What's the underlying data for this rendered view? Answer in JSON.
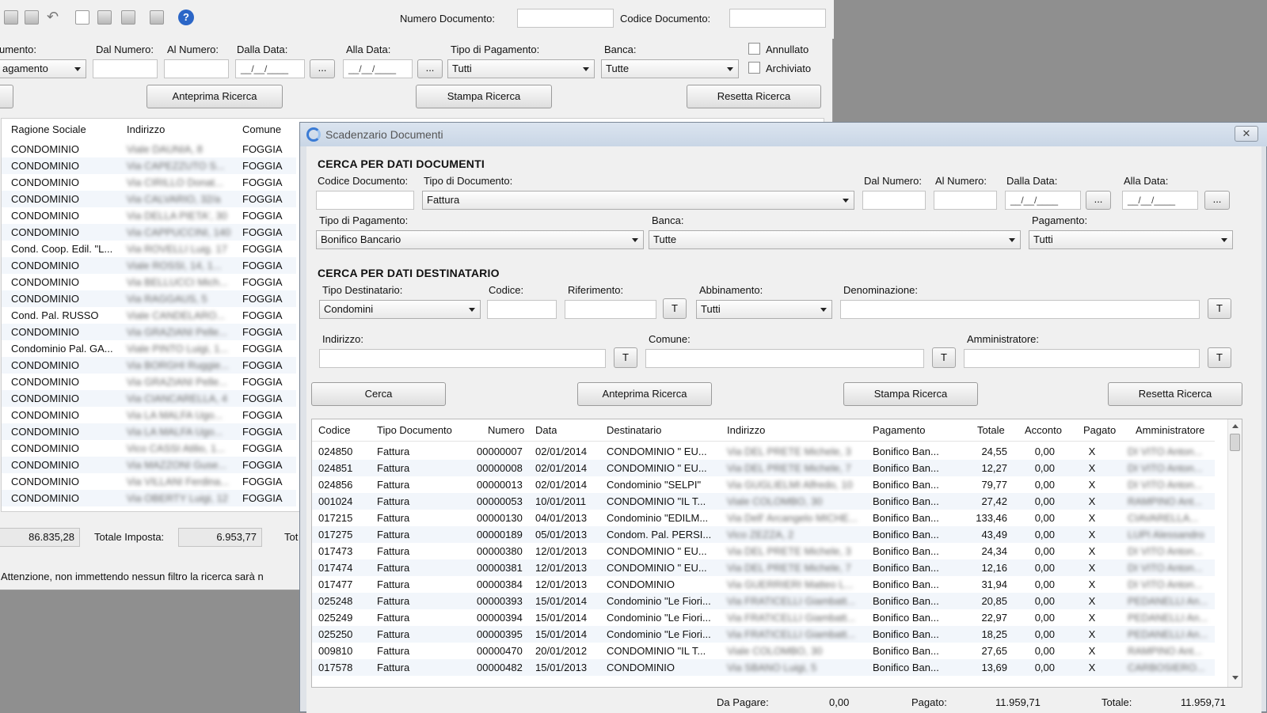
{
  "back_window": {
    "numero_documento_label": "Numero Documento:",
    "codice_documento_label": "Codice Documento:",
    "labels": {
      "documento": "umento:",
      "dal_numero": "Dal Numero:",
      "al_numero": "Al Numero:",
      "dalla_data": "Dalla Data:",
      "alla_data": "Alla Data:",
      "tipo_pagamento": "Tipo di Pagamento:",
      "banca": "Banca:"
    },
    "documento_value": "agamento",
    "date_placeholder": "__/__/____",
    "tipo_pagamento_value": "Tutti",
    "banca_value": "Tutte",
    "annullato_label": "Annullato",
    "archiviato_label": "Archiviato",
    "ellipsis": "...",
    "buttons": {
      "anteprima": "Anteprima Ricerca",
      "stampa": "Stampa Ricerca",
      "resetta": "Resetta Ricerca"
    },
    "table": {
      "columns": [
        "Ragione Sociale",
        "Indirizzo",
        "Comune"
      ],
      "rows": [
        {
          "ragione": "CONDOMINIO",
          "indirizzo": "Viale DAUNIA, 8",
          "comune": "FOGGIA"
        },
        {
          "ragione": "CONDOMINIO",
          "indirizzo": "Via CAPEZZUTO S...",
          "comune": "FOGGIA"
        },
        {
          "ragione": "CONDOMINIO",
          "indirizzo": "Via CIRILLO Donat...",
          "comune": "FOGGIA"
        },
        {
          "ragione": "CONDOMINIO",
          "indirizzo": "Via CALVARIO, 32/a",
          "comune": "FOGGIA"
        },
        {
          "ragione": "CONDOMINIO",
          "indirizzo": "Via DELLA PIETA', 30",
          "comune": "FOGGIA"
        },
        {
          "ragione": "CONDOMINIO",
          "indirizzo": "Via CAPPUCCINI, 140",
          "comune": "FOGGIA"
        },
        {
          "ragione": "Cond. Coop. Edil. \"L...",
          "indirizzo": "Via ROVELLI Luig. 17",
          "comune": "FOGGIA"
        },
        {
          "ragione": "CONDOMINIO",
          "indirizzo": "Viale ROSSI, 14, 1...",
          "comune": "FOGGIA"
        },
        {
          "ragione": "CONDOMINIO",
          "indirizzo": "Via BELLUCCI Mich...",
          "comune": "FOGGIA"
        },
        {
          "ragione": "CONDOMINIO",
          "indirizzo": "Via RAGGAUS, 5",
          "comune": "FOGGIA"
        },
        {
          "ragione": "Cond. Pal. RUSSO",
          "indirizzo": "Viale CANDELARO...",
          "comune": "FOGGIA"
        },
        {
          "ragione": "CONDOMINIO",
          "indirizzo": "Via GRAZIANI Pelle...",
          "comune": "FOGGIA"
        },
        {
          "ragione": "Condominio Pal. GA...",
          "indirizzo": "Viale PINTO Luigi, 1...",
          "comune": "FOGGIA"
        },
        {
          "ragione": "CONDOMINIO",
          "indirizzo": "Via BORGHI Ruggie...",
          "comune": "FOGGIA"
        },
        {
          "ragione": "CONDOMINIO",
          "indirizzo": "Via GRAZIANI Pelle...",
          "comune": "FOGGIA"
        },
        {
          "ragione": "CONDOMINIO",
          "indirizzo": "Via CIANCARELLA, 4",
          "comune": "FOGGIA"
        },
        {
          "ragione": "CONDOMINIO",
          "indirizzo": "Via LA MALFA Ugo...",
          "comune": "FOGGIA"
        },
        {
          "ragione": "CONDOMINIO",
          "indirizzo": "Via LA MALFA Ugo...",
          "comune": "FOGGIA"
        },
        {
          "ragione": "CONDOMINIO",
          "indirizzo": "Vico CASSI Atilio, 1...",
          "comune": "FOGGIA"
        },
        {
          "ragione": "CONDOMINIO",
          "indirizzo": "Via MAZZONI Guse...",
          "comune": "FOGGIA"
        },
        {
          "ragione": "CONDOMINIO",
          "indirizzo": "Via VILLANI Ferdina...",
          "comune": "FOGGIA"
        },
        {
          "ragione": "CONDOMINIO",
          "indirizzo": "Via OBERTY Luigi, 12",
          "comune": "FOGGIA"
        }
      ]
    },
    "footer_amount1": "86.835,28",
    "totale_imposta_label": "Totale Imposta:",
    "totale_imposta_value": "6.953,77",
    "footer_tot_label": "Tot",
    "warning": "Attenzione, non immettendo nessun filtro la ricerca sarà n"
  },
  "front_window": {
    "title": "Scadenzario Documenti",
    "section_documenti": "CERCA PER DATI DOCUMENTI",
    "section_destinatario": "CERCA PER DATI DESTINATARIO",
    "labels": {
      "codice_documento": "Codice Documento:",
      "tipo_documento": "Tipo di Documento:",
      "dal_numero": "Dal Numero:",
      "al_numero": "Al Numero:",
      "dalla_data": "Dalla Data:",
      "alla_data": "Alla Data:",
      "tipo_pagamento": "Tipo di Pagamento:",
      "banca": "Banca:",
      "pagamento": "Pagamento:",
      "tipo_destinatario": "Tipo Destinatario:",
      "codice": "Codice:",
      "riferimento": "Riferimento:",
      "abbinamento": "Abbinamento:",
      "denominazione": "Denominazione:",
      "indirizzo": "Indirizzo:",
      "comune": "Comune:",
      "amministratore": "Amministratore:"
    },
    "values": {
      "tipo_documento": "Fattura",
      "tipo_pagamento": "Bonifico Bancario",
      "banca": "Tutte",
      "pagamento": "Tutti",
      "tipo_destinatario": "Condomini",
      "abbinamento": "Tutti",
      "date_placeholder": "__/__/____"
    },
    "t_button": "T",
    "ellipsis": "...",
    "buttons": {
      "cerca": "Cerca",
      "anteprima": "Anteprima Ricerca",
      "stampa": "Stampa Ricerca",
      "resetta": "Resetta Ricerca"
    },
    "table": {
      "columns": [
        "Codice",
        "Tipo Documento",
        "Numero",
        "Data",
        "Destinatario",
        "Indirizzo",
        "Pagamento",
        "Totale",
        "Acconto",
        "Pagato",
        "Amministratore"
      ],
      "rows": [
        {
          "codice": "024850",
          "tipo": "Fattura",
          "numero": "00000007",
          "data": "02/01/2014",
          "destinatario": "CONDOMINIO \" EU...",
          "indirizzo": "Via DEL PRETE Michele, 3",
          "pagamento": "Bonifico Ban...",
          "totale": "24,55",
          "acconto": "0,00",
          "pagato": "X",
          "amministratore": "DI VITO Anton..."
        },
        {
          "codice": "024851",
          "tipo": "Fattura",
          "numero": "00000008",
          "data": "02/01/2014",
          "destinatario": "CONDOMINIO \" EU...",
          "indirizzo": "Via DEL PRETE Michele, 7",
          "pagamento": "Bonifico Ban...",
          "totale": "12,27",
          "acconto": "0,00",
          "pagato": "X",
          "amministratore": "DI VITO Anton..."
        },
        {
          "codice": "024856",
          "tipo": "Fattura",
          "numero": "00000013",
          "data": "02/01/2014",
          "destinatario": "Condominio \"SELPI\"",
          "indirizzo": "Via GUGLIELMI Alfredo, 10",
          "pagamento": "Bonifico Ban...",
          "totale": "79,77",
          "acconto": "0,00",
          "pagato": "X",
          "amministratore": "DI VITO Anton..."
        },
        {
          "codice": "001024",
          "tipo": "Fattura",
          "numero": "00000053",
          "data": "10/01/2011",
          "destinatario": "CONDOMINIO \"IL T...",
          "indirizzo": "Viale COLOMBO, 30",
          "pagamento": "Bonifico Ban...",
          "totale": "27,42",
          "acconto": "0,00",
          "pagato": "X",
          "amministratore": "RAMPINO Ant..."
        },
        {
          "codice": "017215",
          "tipo": "Fattura",
          "numero": "00000130",
          "data": "04/01/2013",
          "destinatario": "Condominio \"EDILM...",
          "indirizzo": "Via Dell' Arcangelo MICHE...",
          "pagamento": "Bonifico Ban...",
          "totale": "133,46",
          "acconto": "0,00",
          "pagato": "X",
          "amministratore": "CIAVARELLA..."
        },
        {
          "codice": "017275",
          "tipo": "Fattura",
          "numero": "00000189",
          "data": "05/01/2013",
          "destinatario": "Condom. Pal. PERSI...",
          "indirizzo": "Vico ZEZZA, 2",
          "pagamento": "Bonifico Ban...",
          "totale": "43,49",
          "acconto": "0,00",
          "pagato": "X",
          "amministratore": "LUPI Alessandro"
        },
        {
          "codice": "017473",
          "tipo": "Fattura",
          "numero": "00000380",
          "data": "12/01/2013",
          "destinatario": "CONDOMINIO \" EU...",
          "indirizzo": "Via DEL PRETE Michele, 3",
          "pagamento": "Bonifico Ban...",
          "totale": "24,34",
          "acconto": "0,00",
          "pagato": "X",
          "amministratore": "DI VITO Anton..."
        },
        {
          "codice": "017474",
          "tipo": "Fattura",
          "numero": "00000381",
          "data": "12/01/2013",
          "destinatario": "CONDOMINIO \" EU...",
          "indirizzo": "Via DEL PRETE Michele, 7",
          "pagamento": "Bonifico Ban...",
          "totale": "12,16",
          "acconto": "0,00",
          "pagato": "X",
          "amministratore": "DI VITO Anton..."
        },
        {
          "codice": "017477",
          "tipo": "Fattura",
          "numero": "00000384",
          "data": "12/01/2013",
          "destinatario": "CONDOMINIO",
          "indirizzo": "Via GUERRIERI Matteo L...",
          "pagamento": "Bonifico Ban...",
          "totale": "31,94",
          "acconto": "0,00",
          "pagato": "X",
          "amministratore": "DI VITO Anton..."
        },
        {
          "codice": "025248",
          "tipo": "Fattura",
          "numero": "00000393",
          "data": "15/01/2014",
          "destinatario": "Condominio \"Le Fiori...",
          "indirizzo": "Via FRATICELLI Giambatt...",
          "pagamento": "Bonifico Ban...",
          "totale": "20,85",
          "acconto": "0,00",
          "pagato": "X",
          "amministratore": "PEDANELLI An..."
        },
        {
          "codice": "025249",
          "tipo": "Fattura",
          "numero": "00000394",
          "data": "15/01/2014",
          "destinatario": "Condominio \"Le Fiori...",
          "indirizzo": "Via FRATICELLI Giambatt...",
          "pagamento": "Bonifico Ban...",
          "totale": "22,97",
          "acconto": "0,00",
          "pagato": "X",
          "amministratore": "PEDANELLI An..."
        },
        {
          "codice": "025250",
          "tipo": "Fattura",
          "numero": "00000395",
          "data": "15/01/2014",
          "destinatario": "Condominio \"Le Fiori...",
          "indirizzo": "Via FRATICELLI Giambatt...",
          "pagamento": "Bonifico Ban...",
          "totale": "18,25",
          "acconto": "0,00",
          "pagato": "X",
          "amministratore": "PEDANELLI An..."
        },
        {
          "codice": "009810",
          "tipo": "Fattura",
          "numero": "00000470",
          "data": "20/01/2012",
          "destinatario": "CONDOMINIO \"IL T...",
          "indirizzo": "Viale COLOMBO, 30",
          "pagamento": "Bonifico Ban...",
          "totale": "27,65",
          "acconto": "0,00",
          "pagato": "X",
          "amministratore": "RAMPINO Ant..."
        },
        {
          "codice": "017578",
          "tipo": "Fattura",
          "numero": "00000482",
          "data": "15/01/2013",
          "destinatario": "CONDOMINIO",
          "indirizzo": "Via SBANO Luigi, 5",
          "pagamento": "Bonifico Ban...",
          "totale": "13,69",
          "acconto": "0,00",
          "pagato": "X",
          "amministratore": "CARBOSIERO..."
        }
      ]
    },
    "footer": {
      "da_pagare_label": "Da Pagare:",
      "da_pagare_value": "0,00",
      "pagato_label": "Pagato:",
      "pagato_value": "11.959,71",
      "totale_label": "Totale:",
      "totale_value": "11.959,71"
    }
  }
}
